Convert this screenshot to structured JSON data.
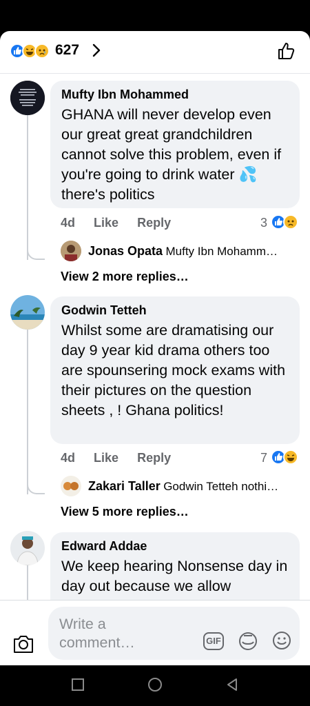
{
  "header": {
    "reaction_count": "627",
    "reactions": [
      "like-icon",
      "laugh-icon",
      "sad-icon"
    ]
  },
  "comments": [
    {
      "author": "Mufty Ibn Mohammed",
      "text": "GHANA will never develop even our great great grandchildren cannot solve this problem, even if you're going to drink water 💦 there's politics",
      "time": "4d",
      "like_label": "Like",
      "reply_label": "Reply",
      "reaction_count": "3",
      "reply_preview": {
        "author": "Jonas Opata",
        "text": "Mufty Ibn Mohamm…"
      },
      "more_replies": "View 2 more replies…"
    },
    {
      "author": "Godwin Tetteh",
      "text": "Whilst some are dramatising our day 9 year kid drama others too are spounsering mock exams with their pictures on the question sheets , ! Ghana politics!",
      "time": "4d",
      "like_label": "Like",
      "reply_label": "Reply",
      "reaction_count": "7",
      "reply_preview": {
        "author": "Zakari Taller",
        "text": "Godwin Tetteh nothi…"
      },
      "more_replies": "View 5 more replies…"
    },
    {
      "author": "Edward Addae",
      "text": "We keep hearing Nonsense day in day out because we allow"
    }
  ],
  "composer": {
    "placeholder": "Write a comment…",
    "gif_label": "GIF"
  },
  "colors": {
    "like_blue": "#1877f2",
    "emoji_yellow": "#f7b928",
    "bubble_bg": "#f0f2f5",
    "meta_gray": "#65676b"
  }
}
